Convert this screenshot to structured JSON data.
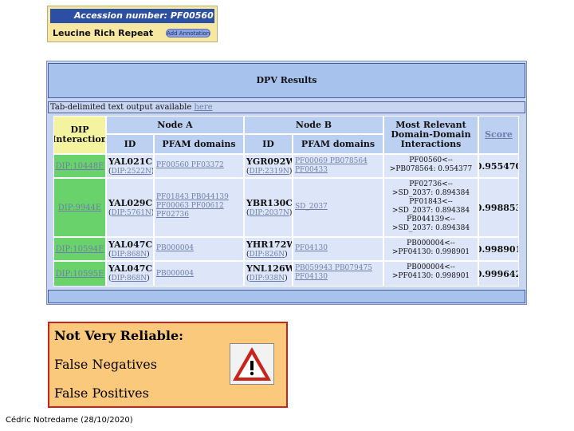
{
  "accession": {
    "label": "Accession number: PF00560",
    "name": "Leucine Rich Repeat",
    "button": "Add Annotation"
  },
  "dpv": {
    "title": "DPV Results",
    "note_text": "Tab-delimited text output available ",
    "note_link": "here",
    "headers": {
      "dip": "DIP Interaction",
      "node_a": "Node A",
      "node_b": "Node B",
      "id": "ID",
      "pfam": "PFAM domains",
      "relevant": "Most Relevant Domain-Domain Interactions",
      "score": "Score"
    },
    "rows": [
      {
        "dip": "DIP:10448E",
        "a_gene": "YAL021C",
        "a_dip": "DIP:2522N",
        "a_pfam": "PF00560 PF03372",
        "b_gene": "YGR092W",
        "b_dip": "DIP:2319N",
        "b_pfam": "PF00069 PB078564 PF00433",
        "rel_l1": "PF00560<--",
        "rel_l2": ">PB078564:  0.954377",
        "score": "0.955470"
      },
      {
        "dip": "DIP:9944E",
        "a_gene": "YAL029C",
        "a_dip": "DIP:5761N",
        "a_pfam": "PF01843 PB044139 PF00063 PF00612 PF02736",
        "b_gene": "YBR130C",
        "b_dip": "DIP:2037N",
        "b_pfam": "SD_2037",
        "rel_l1": "PF02736<--",
        "rel_l2": ">SD_2037:  0.894384",
        "rel_l3": "PF01843<--",
        "rel_l4": ">SD_2037:  0.894384",
        "rel_l5": "PB044139<--",
        "rel_l6": ">SD_2037:  0.894384",
        "score": "0.998853"
      },
      {
        "dip": "DIP:10594E",
        "a_gene": "YAL047C",
        "a_dip": "DIP:868N",
        "a_pfam": "PB000004",
        "b_gene": "YHR172W",
        "b_dip": "DIP:826N",
        "b_pfam": "PF04130",
        "rel_l1": "PB000004<--",
        "rel_l2": ">PF04130:  0.998901",
        "score": "0.998901"
      },
      {
        "dip": "DIP:10595E",
        "a_gene": "YAL047C",
        "a_dip": "DIP:868N",
        "a_pfam": "PB000004",
        "b_gene": "YNL126W",
        "b_dip": "DIP:938N",
        "b_pfam": "PB059943 PB079475 PF04130",
        "rel_l1": "PB000004<--",
        "rel_l2": ">PF04130:  0.998901",
        "score": "0.999642"
      }
    ]
  },
  "warning": {
    "line1": "Not Very Reliable:",
    "line2": "False Negatives",
    "line3": "False Positives",
    "icon": "warning-triangle-icon"
  },
  "footer": "Cédric Notredame (28/10/2020)"
}
